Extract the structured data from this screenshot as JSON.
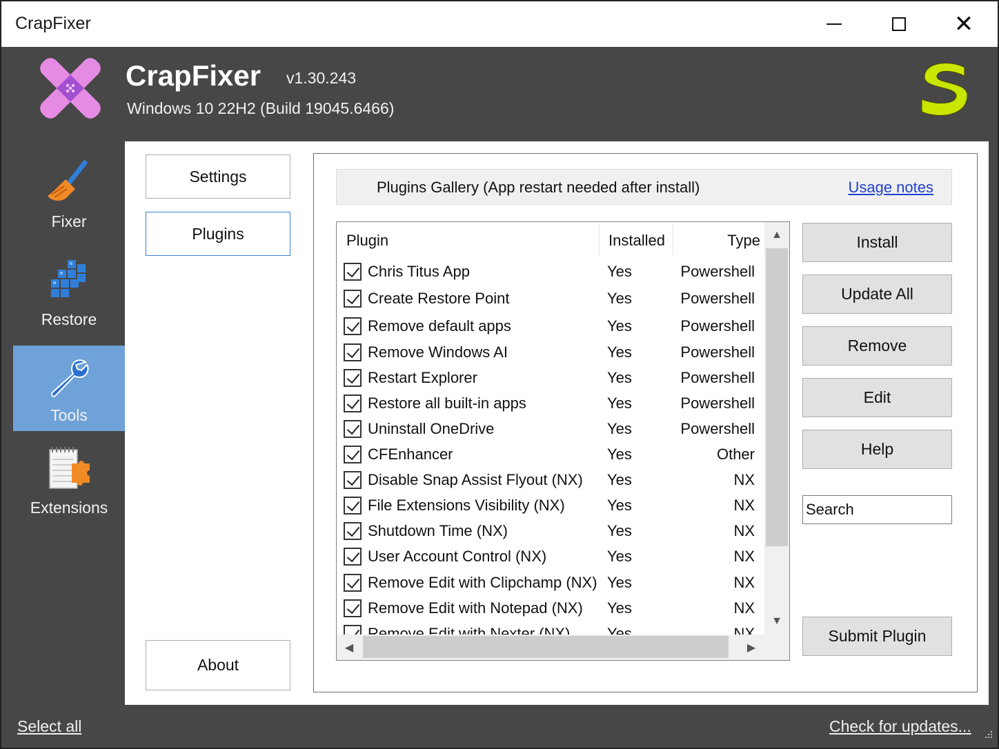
{
  "window": {
    "title": "CrapFixer"
  },
  "header": {
    "app_name": "CrapFixer",
    "version": "v1.30.243",
    "os_info": "Windows 10 22H2 (Build 19045.6466)"
  },
  "nav": {
    "items": [
      {
        "label": "Fixer",
        "icon": "broom-icon"
      },
      {
        "label": "Restore",
        "icon": "restore-blocks-icon"
      },
      {
        "label": "Tools",
        "icon": "wrench-icon",
        "selected": true
      },
      {
        "label": "Extensions",
        "icon": "notepad-puzzle-icon"
      }
    ]
  },
  "tools_menu": {
    "settings": "Settings",
    "plugins": "Plugins",
    "about": "About"
  },
  "gallery": {
    "title": "Plugins Gallery (App restart needed after install)",
    "usage_notes": "Usage notes"
  },
  "plugin_table": {
    "columns": [
      "Plugin",
      "Installed",
      "Type"
    ],
    "rows": [
      {
        "name": "Chris Titus App",
        "installed": "Yes",
        "type": "Powershell",
        "checked": true
      },
      {
        "name": "Create Restore Point",
        "installed": "Yes",
        "type": "Powershell",
        "checked": true
      },
      {
        "name": "Remove default apps",
        "installed": "Yes",
        "type": "Powershell",
        "checked": true
      },
      {
        "name": "Remove Windows AI",
        "installed": "Yes",
        "type": "Powershell",
        "checked": true
      },
      {
        "name": "Restart Explorer",
        "installed": "Yes",
        "type": "Powershell",
        "checked": true
      },
      {
        "name": "Restore all built-in apps",
        "installed": "Yes",
        "type": "Powershell",
        "checked": true
      },
      {
        "name": "Uninstall OneDrive",
        "installed": "Yes",
        "type": "Powershell",
        "checked": true
      },
      {
        "name": "CFEnhancer",
        "installed": "Yes",
        "type": "Other",
        "checked": true
      },
      {
        "name": "Disable Snap Assist Flyout (NX)",
        "installed": "Yes",
        "type": "NX",
        "checked": true
      },
      {
        "name": "File Extensions Visibility (NX)",
        "installed": "Yes",
        "type": "NX",
        "checked": true
      },
      {
        "name": "Shutdown Time (NX)",
        "installed": "Yes",
        "type": "NX",
        "checked": true
      },
      {
        "name": "User Account Control (NX)",
        "installed": "Yes",
        "type": "NX",
        "checked": true
      },
      {
        "name": "Remove Edit with Clipchamp (NX)",
        "installed": "Yes",
        "type": "NX",
        "checked": true
      },
      {
        "name": "Remove Edit with Notepad (NX)",
        "installed": "Yes",
        "type": "NX",
        "checked": true
      },
      {
        "name": "Remove Edit with Nexter (NX)",
        "installed": "Yes",
        "type": "NX",
        "checked": true
      }
    ]
  },
  "actions": {
    "install": "Install",
    "update_all": "Update All",
    "remove": "Remove",
    "edit": "Edit",
    "help": "Help",
    "search_value": "Search",
    "submit_plugin": "Submit Plugin"
  },
  "footer": {
    "select_all": "Select all",
    "check_updates": "Check for updates..."
  },
  "colors": {
    "dark_bg": "#474747",
    "nav_selected": "#6fa2d8",
    "logo_pink": "#e58be3",
    "logo_purple": "#a24fd1",
    "s_logo": "#c8e600",
    "link_blue": "#1f3fd0"
  }
}
